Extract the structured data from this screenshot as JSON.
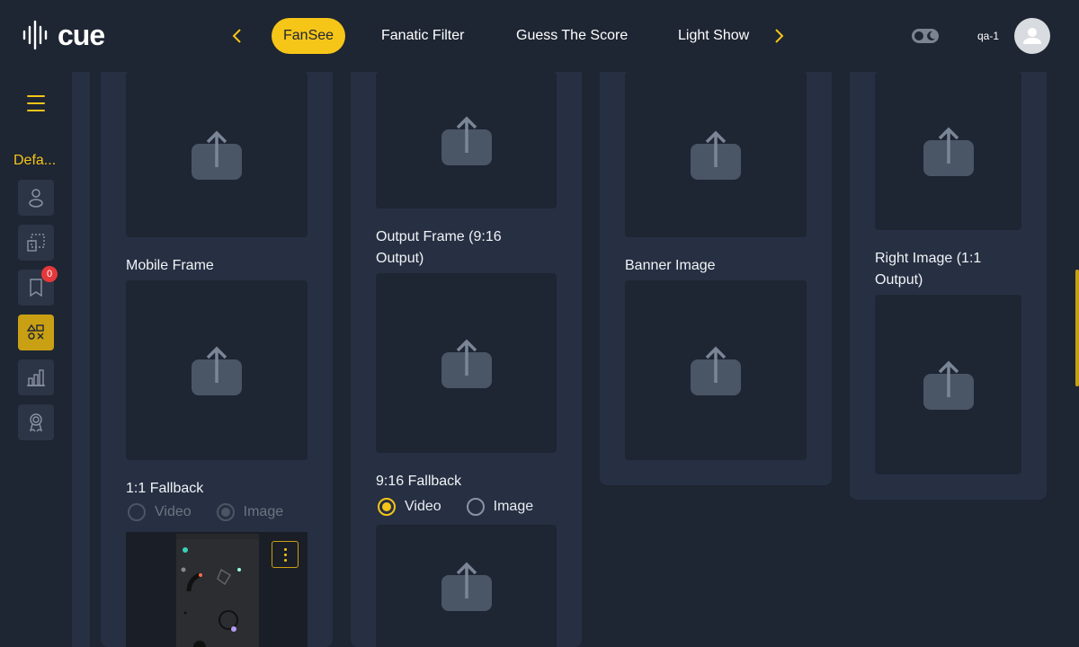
{
  "app": {
    "logo_text": "cue"
  },
  "tabs": [
    {
      "label": "FanSee",
      "active": true
    },
    {
      "label": "Fanatic Filter",
      "active": false
    },
    {
      "label": "Guess The Score",
      "active": false
    },
    {
      "label": "Light Show",
      "active": false
    }
  ],
  "user": {
    "name": "qa-1"
  },
  "sidebar": {
    "section_label": "Defa...",
    "items": [
      {
        "icon": "user-icon"
      },
      {
        "icon": "layout-icon"
      },
      {
        "icon": "bookmark-icon",
        "badge": "0"
      },
      {
        "icon": "shapes-icon",
        "active": true
      },
      {
        "icon": "chart-icon"
      },
      {
        "icon": "award-icon"
      }
    ]
  },
  "columns": {
    "col1": {
      "label_mid": "Mobile Frame",
      "fallback": {
        "label": "1:1 Fallback",
        "opt_video": "Video",
        "opt_image": "Image",
        "selected": "Image",
        "disabled": true
      }
    },
    "col2": {
      "label_mid": "Output Frame (9:16 Output)",
      "fallback": {
        "label": "9:16 Fallback",
        "opt_video": "Video",
        "opt_image": "Image",
        "selected": "Video",
        "disabled": false
      }
    },
    "col3": {
      "label_mid": "Banner Image"
    },
    "col4": {
      "label_mid": "Right Image (1:1 Output)"
    }
  },
  "colors": {
    "accent": "#f5c518",
    "background": "#1e2533",
    "panel": "#263042"
  }
}
